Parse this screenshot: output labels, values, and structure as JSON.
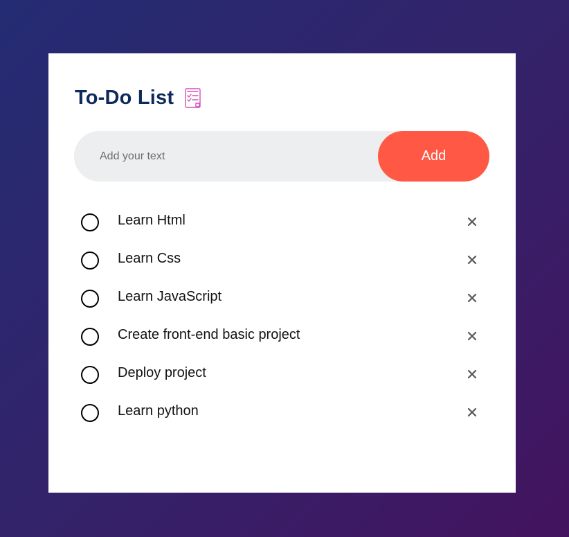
{
  "header": {
    "title": "To-Do List",
    "icon": "checklist-icon"
  },
  "input": {
    "placeholder": "Add your text",
    "value": ""
  },
  "add_button": {
    "label": "Add"
  },
  "todos": [
    {
      "text": "Learn Html",
      "done": false
    },
    {
      "text": "Learn Css",
      "done": false
    },
    {
      "text": "Learn JavaScript",
      "done": false
    },
    {
      "text": "Create front-end basic project",
      "done": false
    },
    {
      "text": "Deploy project",
      "done": false
    },
    {
      "text": "Learn python",
      "done": false
    }
  ],
  "colors": {
    "background_start": "#242c73",
    "background_end": "#43135f",
    "card": "#ffffff",
    "title": "#0e2a5c",
    "accent": "#ff5945",
    "input_bg": "#edeef0",
    "icon_pink": "#d64fb8"
  }
}
